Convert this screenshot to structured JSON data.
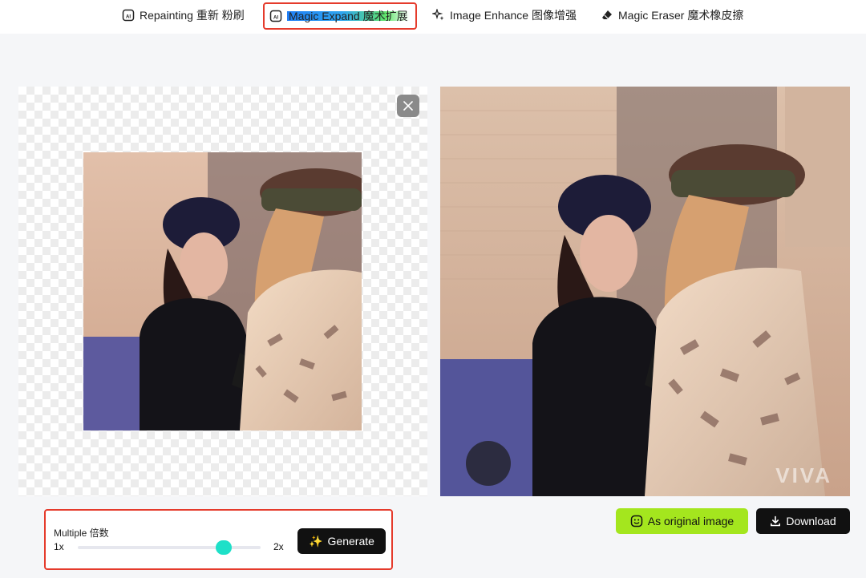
{
  "tabs": [
    {
      "label": "Repainting 重新 粉刷",
      "icon": "ai-image-icon",
      "active": false
    },
    {
      "label": "Magic Expand 魔术扩展",
      "icon": "ai-image-icon",
      "active": true
    },
    {
      "label": "Image Enhance 图像增强",
      "icon": "sparkle-icon",
      "active": false
    },
    {
      "label": "Magic Eraser 魔术橡皮擦",
      "icon": "eraser-icon",
      "active": false
    }
  ],
  "controls": {
    "multiple_label": "Multiple 倍数",
    "min_label": "1x",
    "max_label": "2x",
    "slider_value": 1.8,
    "slider_min": 1,
    "slider_max": 2,
    "generate_label": "Generate",
    "generate_icon": "✨"
  },
  "result_actions": {
    "original_label": "As original image",
    "download_label": "Download"
  },
  "watermark": "VIVA",
  "colors": {
    "accent_green": "#a4e61e",
    "slider_thumb": "#1ee0c8",
    "highlight_border": "#e53b2c"
  }
}
